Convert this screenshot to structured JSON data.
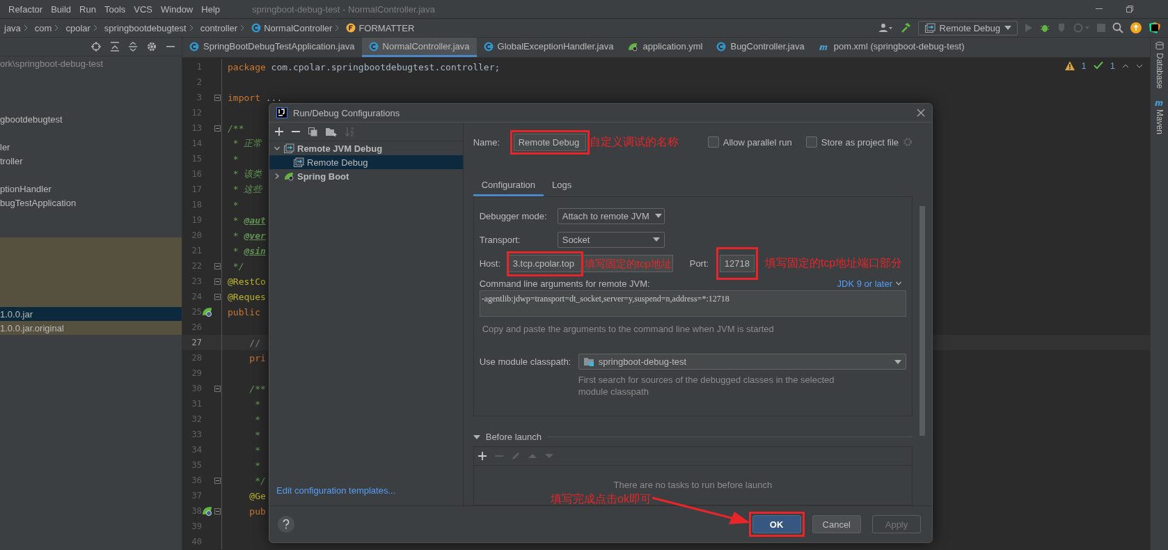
{
  "menu": [
    {
      "label": "Refactor"
    },
    {
      "label": "Build"
    },
    {
      "label": "Run"
    },
    {
      "label": "Tools"
    },
    {
      "label": "VCS"
    },
    {
      "label": "Window"
    },
    {
      "label": "Help"
    }
  ],
  "window": {
    "title": "springboot-debug-test - NormalController.java"
  },
  "breadcrumbs": [
    {
      "label": "java",
      "kind": "folder"
    },
    {
      "label": "com",
      "kind": "folder"
    },
    {
      "label": "cpolar",
      "kind": "folder"
    },
    {
      "label": "springbootdebugtest",
      "kind": "folder"
    },
    {
      "label": "controller",
      "kind": "folder"
    },
    {
      "label": "NormalController",
      "kind": "class"
    },
    {
      "label": "FORMATTER",
      "kind": "field"
    }
  ],
  "run_config": {
    "label": "Remote Debug"
  },
  "editor_tabs": [
    {
      "label": "SpringBootDebugTestApplication.java",
      "kind": "class",
      "selected": false
    },
    {
      "label": "NormalController.java",
      "kind": "class",
      "selected": true
    },
    {
      "label": "GlobalExceptionHandler.java",
      "kind": "class",
      "selected": false
    },
    {
      "label": "application.yml",
      "kind": "spring",
      "selected": false
    },
    {
      "label": "BugController.java",
      "kind": "class",
      "selected": false
    },
    {
      "label": "pom.xml (springboot-debug-test)",
      "kind": "maven",
      "selected": false
    }
  ],
  "project_tree": {
    "path": "ork\\springboot-debug-test",
    "rows": [
      {
        "selected": false,
        "highlighted": false
      },
      {
        "selected": false,
        "highlighted": false
      },
      {
        "selected": false,
        "highlighted": false
      },
      {
        "label": "gbootdebugtest",
        "selected": false,
        "highlighted": false
      },
      {
        "selected": false,
        "highlighted": false
      },
      {
        "label": "ler",
        "selected": false,
        "highlighted": false
      },
      {
        "label": "troller",
        "selected": false,
        "highlighted": false
      },
      {
        "selected": false,
        "highlighted": false
      },
      {
        "label": "ptionHandler",
        "selected": false,
        "highlighted": false
      },
      {
        "label": "bugTestApplication",
        "selected": false,
        "highlighted": false
      },
      {
        "selected": false,
        "highlighted": false
      },
      {
        "selected": false,
        "highlighted": false
      },
      {
        "selected": false,
        "highlighted": true
      },
      {
        "selected": false,
        "highlighted": true
      },
      {
        "selected": false,
        "highlighted": true
      },
      {
        "selected": false,
        "highlighted": true
      },
      {
        "selected": false,
        "highlighted": true
      },
      {
        "label": "1.0.0.jar",
        "selected": true,
        "highlighted": false
      },
      {
        "label": "1.0.0.jar.original",
        "selected": false,
        "highlighted": true
      }
    ]
  },
  "editor": {
    "inspections": {
      "warnings": "1",
      "weak_warnings": "1"
    },
    "lines": [
      {
        "number": "1",
        "fold": false,
        "current": false,
        "gutter_icon": false,
        "segments": [
          {
            "text": "package",
            "kind": "keyword"
          },
          {
            "text": " com.cpolar.springbootdebugtest.controller;",
            "kind": "plain"
          }
        ]
      },
      {
        "number": "2",
        "fold": false,
        "current": false,
        "gutter_icon": false
      },
      {
        "number": "3",
        "fold": true,
        "current": false,
        "gutter_icon": false,
        "segments": [
          {
            "text": "import",
            "kind": "keyword"
          },
          {
            "text": " ...",
            "kind": "plain"
          }
        ]
      },
      {
        "number": "12",
        "fold": false,
        "current": false,
        "gutter_icon": false
      },
      {
        "number": "13",
        "fold": true,
        "current": false,
        "gutter_icon": false,
        "segments": [
          {
            "text": "/**",
            "kind": "doc"
          }
        ]
      },
      {
        "number": "14",
        "fold": false,
        "current": false,
        "gutter_icon": false,
        "segments": [
          {
            "text": " * 正常",
            "kind": "doc"
          }
        ]
      },
      {
        "number": "15",
        "fold": false,
        "current": false,
        "gutter_icon": false,
        "segments": [
          {
            "text": " *",
            "kind": "doc"
          }
        ]
      },
      {
        "number": "16",
        "fold": false,
        "current": false,
        "gutter_icon": false,
        "segments": [
          {
            "text": " * 该类",
            "kind": "doc"
          }
        ]
      },
      {
        "number": "17",
        "fold": false,
        "current": false,
        "gutter_icon": false,
        "segments": [
          {
            "text": " * 这些",
            "kind": "doc"
          }
        ]
      },
      {
        "number": "18",
        "fold": false,
        "current": false,
        "gutter_icon": false,
        "segments": [
          {
            "text": " *",
            "kind": "doc"
          }
        ]
      },
      {
        "number": "19",
        "fold": false,
        "current": false,
        "gutter_icon": false,
        "segments": [
          {
            "text": " * ",
            "kind": "doc"
          },
          {
            "text": "@aut",
            "kind": "doctag"
          }
        ]
      },
      {
        "number": "20",
        "fold": false,
        "current": false,
        "gutter_icon": false,
        "segments": [
          {
            "text": " * ",
            "kind": "doc"
          },
          {
            "text": "@ver",
            "kind": "doctag"
          }
        ]
      },
      {
        "number": "21",
        "fold": false,
        "current": false,
        "gutter_icon": false,
        "segments": [
          {
            "text": " * ",
            "kind": "doc"
          },
          {
            "text": "@sin",
            "kind": "doctag"
          }
        ]
      },
      {
        "number": "22",
        "fold": true,
        "current": false,
        "gutter_icon": false,
        "segments": [
          {
            "text": " */",
            "kind": "doc"
          }
        ]
      },
      {
        "number": "23",
        "fold": true,
        "current": false,
        "gutter_icon": false,
        "segments": [
          {
            "text": "@RestCo",
            "kind": "annotation"
          }
        ]
      },
      {
        "number": "24",
        "fold": true,
        "current": false,
        "gutter_icon": false,
        "segments": [
          {
            "text": "@Reques",
            "kind": "annotation"
          }
        ]
      },
      {
        "number": "25",
        "fold": false,
        "current": false,
        "gutter_icon": true,
        "segments": [
          {
            "text": "public",
            "kind": "keyword"
          }
        ]
      },
      {
        "number": "26",
        "fold": false,
        "current": false,
        "gutter_icon": false
      },
      {
        "number": "27",
        "fold": false,
        "current": true,
        "gutter_icon": false,
        "segments": [
          {
            "text": "    // ",
            "kind": "comment"
          }
        ]
      },
      {
        "number": "28",
        "fold": false,
        "current": false,
        "gutter_icon": false,
        "segments": [
          {
            "text": "    pri",
            "kind": "keyword"
          }
        ]
      },
      {
        "number": "29",
        "fold": false,
        "current": false,
        "gutter_icon": false
      },
      {
        "number": "30",
        "fold": true,
        "current": false,
        "gutter_icon": false,
        "segments": [
          {
            "text": "    /**",
            "kind": "doc"
          }
        ]
      },
      {
        "number": "31",
        "fold": false,
        "current": false,
        "gutter_icon": false,
        "segments": [
          {
            "text": "     *",
            "kind": "doc"
          }
        ]
      },
      {
        "number": "32",
        "fold": false,
        "current": false,
        "gutter_icon": false,
        "segments": [
          {
            "text": "     *",
            "kind": "doc"
          }
        ]
      },
      {
        "number": "33",
        "fold": false,
        "current": false,
        "gutter_icon": false,
        "segments": [
          {
            "text": "     *",
            "kind": "doc"
          }
        ]
      },
      {
        "number": "34",
        "fold": false,
        "current": false,
        "gutter_icon": false,
        "segments": [
          {
            "text": "     *",
            "kind": "doc"
          }
        ]
      },
      {
        "number": "35",
        "fold": false,
        "current": false,
        "gutter_icon": false,
        "segments": [
          {
            "text": "     *",
            "kind": "doc"
          }
        ]
      },
      {
        "number": "36",
        "fold": true,
        "current": false,
        "gutter_icon": false,
        "segments": [
          {
            "text": "     */",
            "kind": "doc"
          }
        ]
      },
      {
        "number": "37",
        "fold": false,
        "current": false,
        "gutter_icon": false,
        "segments": [
          {
            "text": "    @Ge",
            "kind": "annotation"
          }
        ]
      },
      {
        "number": "38",
        "fold": true,
        "current": false,
        "gutter_icon": true,
        "segments": [
          {
            "text": "    pub",
            "kind": "keyword"
          }
        ]
      },
      {
        "number": "39",
        "fold": false,
        "current": false,
        "gutter_icon": false
      },
      {
        "number": "40",
        "fold": false,
        "current": false,
        "gutter_icon": false
      }
    ]
  },
  "tool_strip": [
    {
      "label": "Database",
      "kind": "database"
    },
    {
      "label": "Maven",
      "kind": "maven"
    }
  ],
  "dialog": {
    "title": "Run/Debug Configurations",
    "tree": [
      {
        "label": "Remote JVM Debug",
        "kind": "remote",
        "expanded": true,
        "selected": false,
        "children": [
          {
            "label": "Remote Debug",
            "kind": "remote",
            "selected": true
          }
        ]
      },
      {
        "label": "Spring Boot",
        "kind": "spring",
        "expanded": false,
        "selected": false
      }
    ],
    "templates_link": "Edit configuration templates...",
    "name": {
      "label": "Name:",
      "value": "Remote Debug"
    },
    "options": [
      {
        "label": "Allow parallel run",
        "checked": false
      },
      {
        "label": "Store as project file",
        "checked": false
      }
    ],
    "tabs": [
      {
        "label": "Configuration",
        "selected": true
      },
      {
        "label": "Logs",
        "selected": false
      }
    ],
    "debugger_mode": {
      "label": "Debugger mode:",
      "value": "Attach to remote JVM"
    },
    "transport": {
      "label": "Transport:",
      "value": "Socket"
    },
    "host": {
      "label": "Host:",
      "value": "3.tcp.cpolar.top"
    },
    "port": {
      "label": "Port:",
      "value": "12718"
    },
    "command_line": {
      "label": "Command line arguments for remote JVM:",
      "jdk": "JDK 9 or later",
      "value": "-agentlib:jdwp=transport=dt_socket,server=y,suspend=n,address=*:12718",
      "hint": "Copy and paste the arguments to the command line when JVM is started"
    },
    "module_classpath": {
      "label": "Use module classpath:",
      "value": "springboot-debug-test",
      "hint": "First search for sources of the debugged classes in the selected module classpath"
    },
    "before_launch": {
      "title": "Before launch",
      "expanded": true,
      "empty_text": "There are no tasks to run before launch"
    },
    "buttons": [
      {
        "label": "OK",
        "kind": "primary",
        "disabled": false
      },
      {
        "label": "Cancel",
        "kind": "normal",
        "disabled": false
      },
      {
        "label": "Apply",
        "kind": "normal",
        "disabled": true
      }
    ],
    "annotations": {
      "name_note": "自定义调试的名称",
      "host_note": "填写固定的tcp地址",
      "port_note": "填写固定的tcp地址端口部分",
      "ok_note": "填写完成点击ok即可"
    }
  }
}
